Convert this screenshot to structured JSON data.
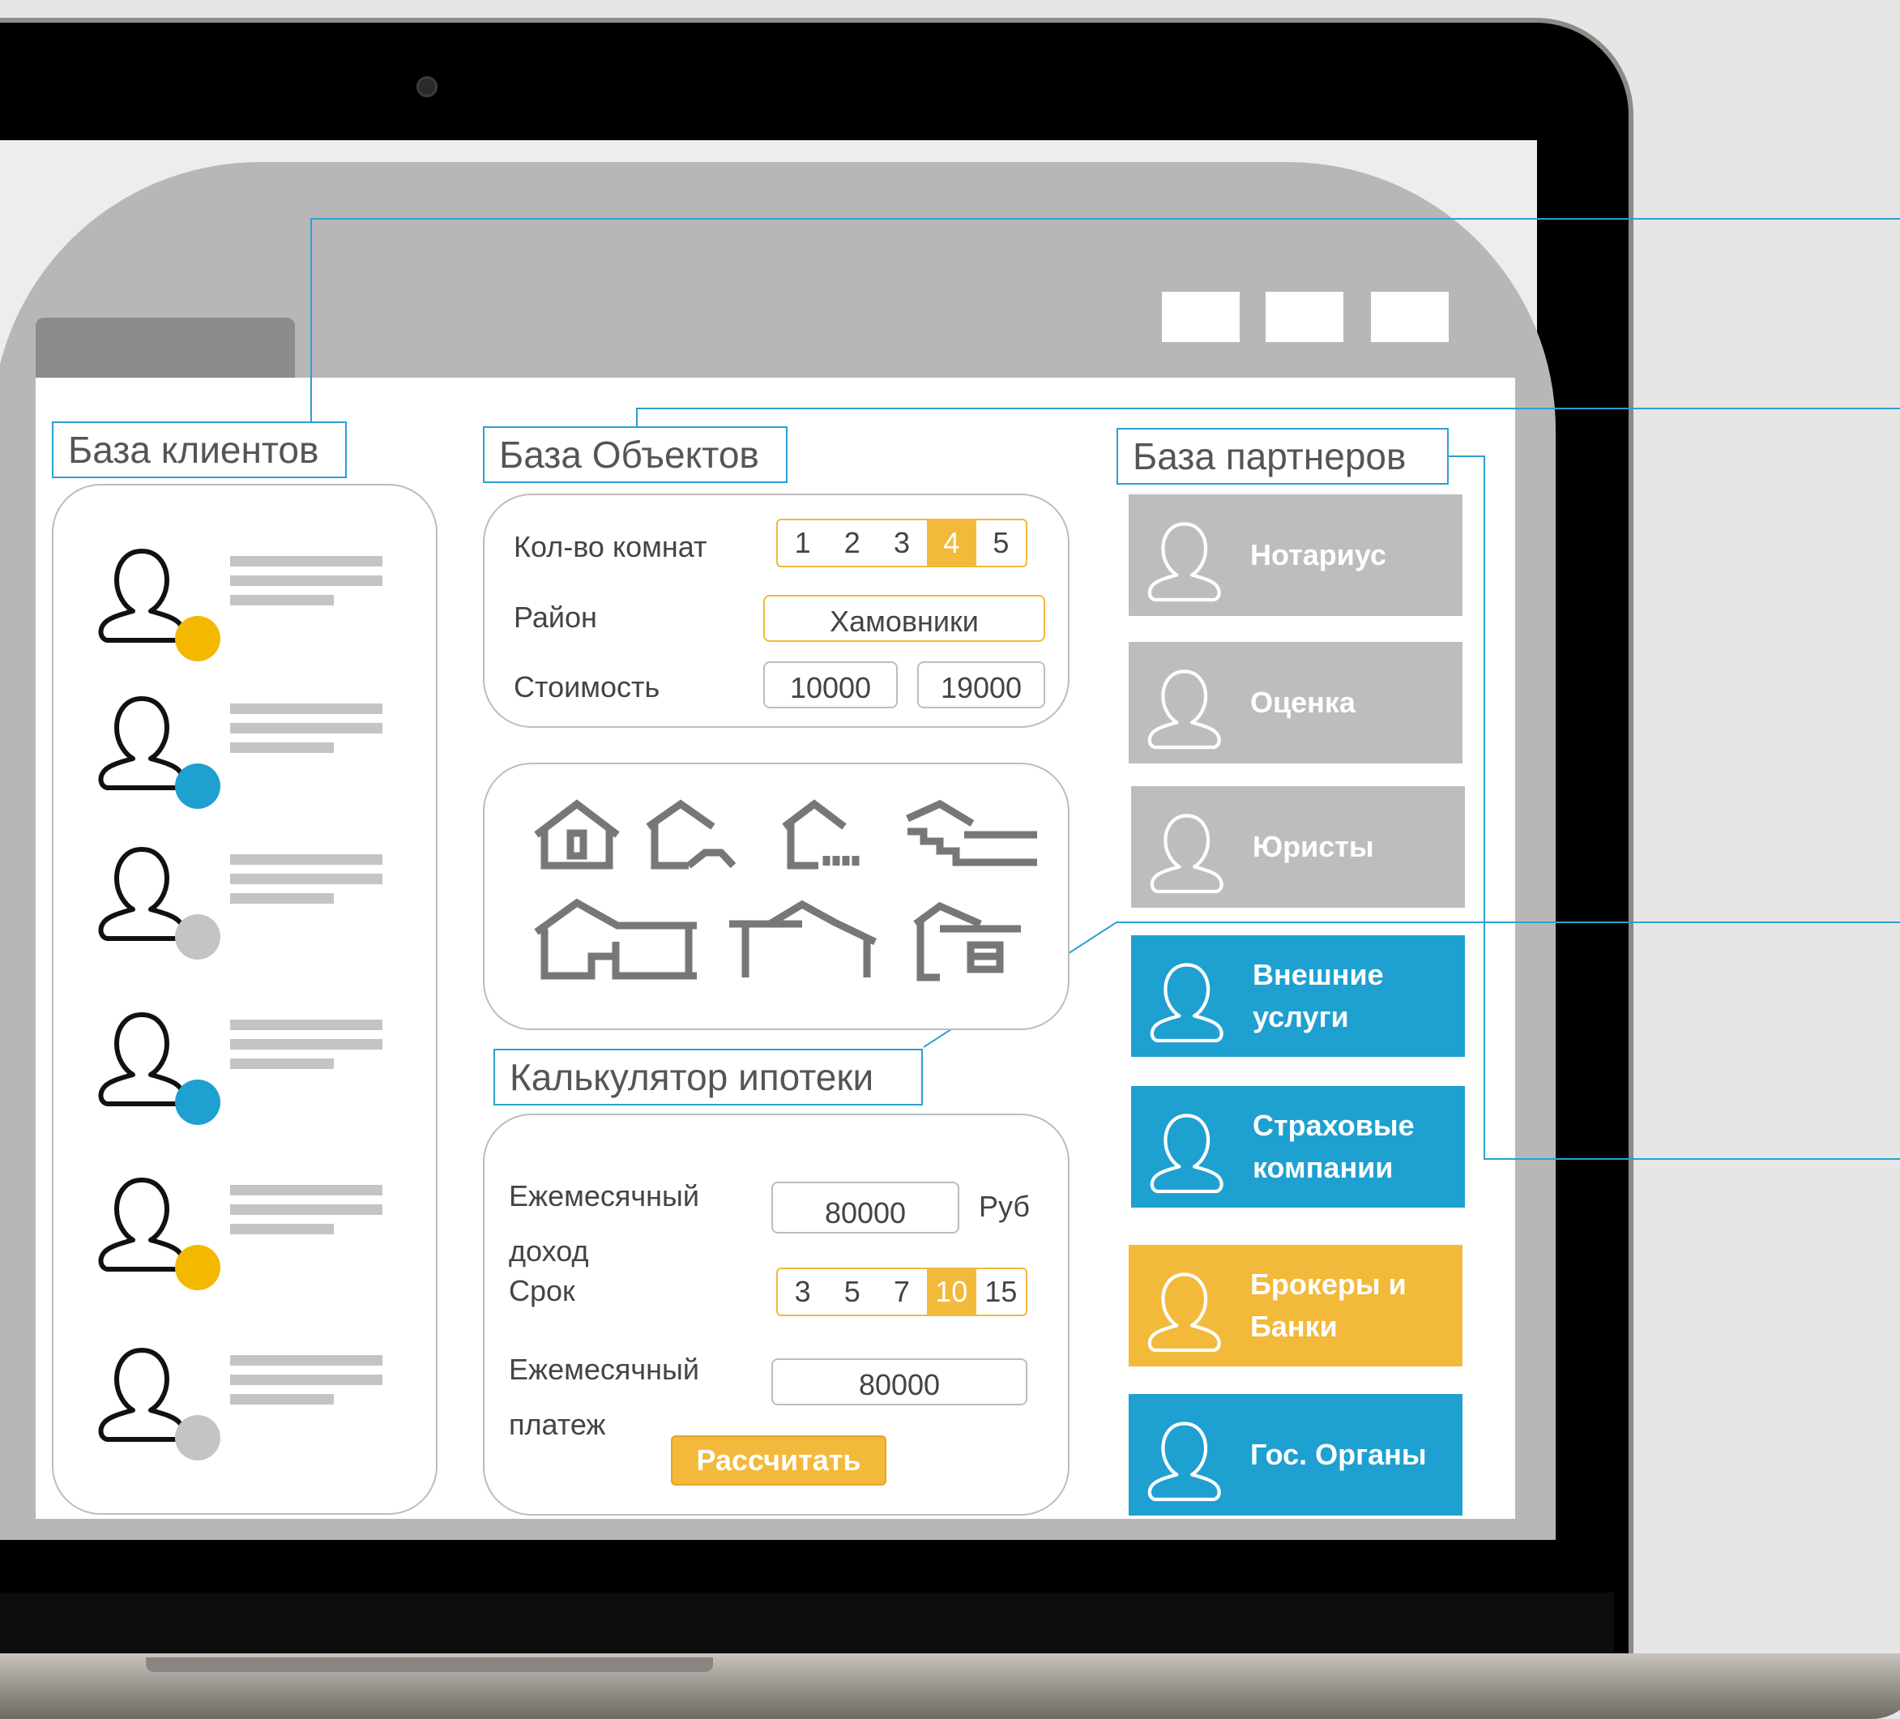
{
  "colors": {
    "accent_blue": "#1ea0d0",
    "accent_orange": "#f2b93b",
    "partner_gray": "#bdbdbd",
    "status_gray": "#bdbdbd"
  },
  "clients": {
    "title": "База клиентов",
    "items": [
      {
        "status": "yellow"
      },
      {
        "status": "blue"
      },
      {
        "status": "gray"
      },
      {
        "status": "blue"
      },
      {
        "status": "yellow"
      },
      {
        "status": "gray"
      }
    ]
  },
  "objects": {
    "title": "База Объектов",
    "rooms_label": "Кол-во комнат",
    "rooms_options": [
      "1",
      "2",
      "3",
      "4",
      "5"
    ],
    "rooms_selected": "4",
    "district_label": "Район",
    "district_value": "Хамовники",
    "price_label": "Стоимость",
    "price_from": "10000",
    "price_to": "19000",
    "house_icons": [
      "house-door-icon",
      "house-roof-icon",
      "house-fence-icon",
      "house-stairs-icon",
      "house-garage-icon",
      "house-carport-icon",
      "house-car-icon"
    ]
  },
  "calculator": {
    "title": "Калькулятор ипотеки",
    "income_label": "Ежемесячный доход",
    "income_value": "80000",
    "currency": "Руб",
    "term_label": "Срок",
    "term_options": [
      "3",
      "5",
      "7",
      "10",
      "15"
    ],
    "term_selected": "10",
    "payment_label": "Ежемесячный платеж",
    "payment_value": "80000",
    "button_label": "Рассчитать"
  },
  "partners": {
    "title": "База партнеров",
    "items": [
      {
        "label": "Нотариус",
        "color": "gray"
      },
      {
        "label": "Оценка",
        "color": "gray"
      },
      {
        "label": "Юристы",
        "color": "gray"
      },
      {
        "label": "Внешние услуги",
        "color": "blue"
      },
      {
        "label": "Страховые компании",
        "color": "blue"
      },
      {
        "label": "Брокеры и Банки",
        "color": "orange"
      },
      {
        "label": "Гос. Органы",
        "color": "blue"
      }
    ]
  }
}
